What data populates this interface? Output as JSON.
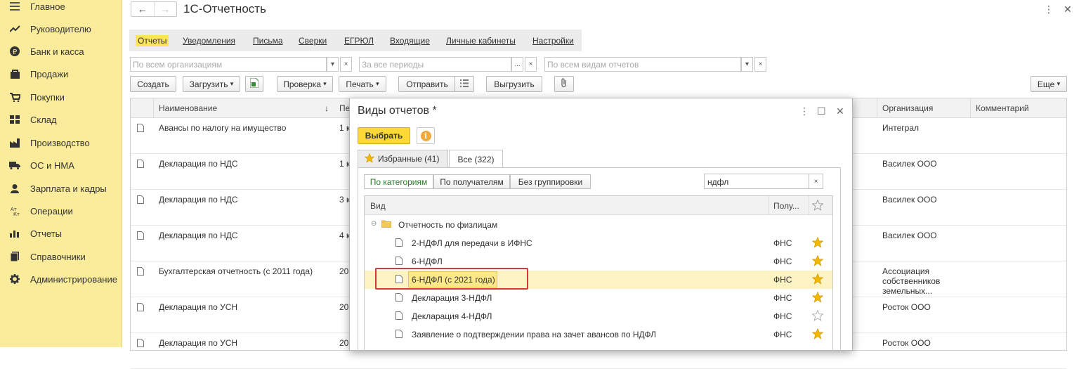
{
  "sidebar": {
    "items": [
      {
        "label": "Главное",
        "icon": "menu-icon"
      },
      {
        "label": "Руководителю",
        "icon": "trend-icon"
      },
      {
        "label": "Банк и касса",
        "icon": "ruble-icon"
      },
      {
        "label": "Продажи",
        "icon": "bag-icon"
      },
      {
        "label": "Покупки",
        "icon": "cart-icon"
      },
      {
        "label": "Склад",
        "icon": "warehouse-icon"
      },
      {
        "label": "Производство",
        "icon": "factory-icon"
      },
      {
        "label": "ОС и НМА",
        "icon": "truck-icon"
      },
      {
        "label": "Зарплата и кадры",
        "icon": "person-icon"
      },
      {
        "label": "Операции",
        "icon": "operations-icon"
      },
      {
        "label": "Отчеты",
        "icon": "bar-chart-icon"
      },
      {
        "label": "Справочники",
        "icon": "book-icon"
      },
      {
        "label": "Администрирование",
        "icon": "gear-icon"
      }
    ]
  },
  "header": {
    "title": "1С-Отчетность",
    "back_icon": "←",
    "forward_icon": "→",
    "more_icon": "⋮",
    "close_icon": "✕"
  },
  "tabs": [
    {
      "label": "Отчеты",
      "active": true
    },
    {
      "label": "Уведомления"
    },
    {
      "label": "Письма"
    },
    {
      "label": "Сверки"
    },
    {
      "label": "ЕГРЮЛ"
    },
    {
      "label": "Входящие"
    },
    {
      "label": "Личные кабинеты"
    },
    {
      "label": "Настройки"
    }
  ],
  "filters": {
    "org_placeholder": "По всем организациям",
    "period_placeholder": "За все периоды",
    "kind_placeholder": "По всем видам отчетов",
    "dropdown_glyph": "▾",
    "clear_glyph": "×",
    "ellipsis_glyph": "..."
  },
  "commands": {
    "create": "Создать",
    "load": "Загрузить",
    "check": "Проверка",
    "print": "Печать",
    "send": "Отправить",
    "unload": "Выгрузить",
    "more": "Еще",
    "dropdown_glyph": "▾"
  },
  "table": {
    "columns": {
      "name": "Наименование",
      "sort_glyph": "↓",
      "period": "Пе",
      "org": "Организация",
      "comment": "Комментарий"
    },
    "rows": [
      {
        "name": "Авансы по налогу на имущество",
        "period": "1 к",
        "org": "Интеграл"
      },
      {
        "name": "Декларация по НДС",
        "period": "1 к",
        "org": "Василек ООО"
      },
      {
        "name": "Декларация по НДС",
        "period": "3 к",
        "org": "Василек ООО"
      },
      {
        "name": "Декларация по НДС",
        "period": "4 к",
        "org": "Василек ООО"
      },
      {
        "name": "Бухгалтерская отчетность (с 2011 года)",
        "period": "20",
        "org": "Ассоциация собственников земельных..."
      },
      {
        "name": "Декларация по УСН",
        "period": "20",
        "org": "Росток ООО"
      },
      {
        "name": "Декларация по УСН",
        "period": "20",
        "org": "Росток ООО"
      }
    ]
  },
  "modal": {
    "title": "Виды отчетов *",
    "more_icon": "⋮",
    "maximize_icon": "☐",
    "close_icon": "✕",
    "choose_button": "Выбрать",
    "info_glyph": "i",
    "tab_favorites": "Избранные (41)",
    "tab_all": "Все (322)",
    "group_by_category": "По категориям",
    "group_by_receiver": "По получателям",
    "no_grouping": "Без группировки",
    "search_value": "ндфл",
    "search_clear": "×",
    "list_columns": {
      "kind": "Вид",
      "receiver": "Полу..."
    },
    "folder": {
      "label": "Отчетность по физлицам",
      "collapse_glyph": "⊖"
    },
    "items": [
      {
        "name": "2-НДФЛ для передачи в ИФНС",
        "receiver": "ФНС",
        "favorite": true
      },
      {
        "name": "6-НДФЛ",
        "receiver": "ФНС",
        "favorite": true
      },
      {
        "name": "6-НДФЛ (с 2021 года)",
        "receiver": "ФНС",
        "favorite": true,
        "selected": true
      },
      {
        "name": "Декларация 3-НДФЛ",
        "receiver": "ФНС",
        "favorite": true
      },
      {
        "name": "Декларация 4-НДФЛ",
        "receiver": "ФНС",
        "favorite": false
      },
      {
        "name": "Заявление о подтверждении права на зачет авансов по НДФЛ",
        "receiver": "ФНС",
        "favorite": true
      }
    ]
  },
  "colors": {
    "sidebar": "#fbec9c",
    "accent": "#fdd935",
    "selection": "#fdf3c3",
    "highlight_frame": "#cf3b3b",
    "star": "#f2b800"
  }
}
